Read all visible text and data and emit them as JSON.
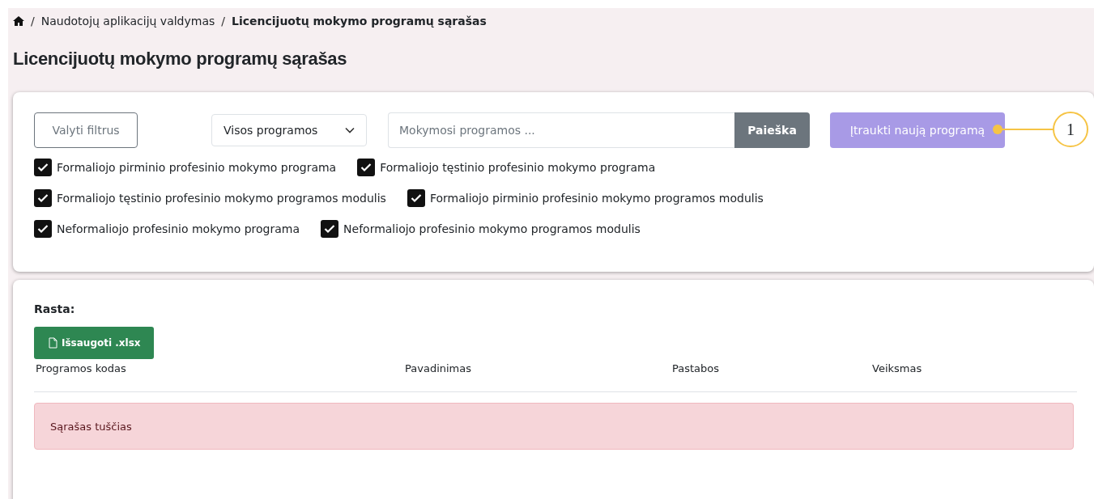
{
  "breadcrumb": {
    "items": [
      {
        "separator": "/",
        "label": "Naudotojų aplikacijų valdymas",
        "current": false
      },
      {
        "separator": "/",
        "label": "Licencijuotų mokymo programų sąrašas",
        "current": true
      }
    ]
  },
  "title": "Licencijuotų mokymo programų sąrašas",
  "filters": {
    "clear_button": "Valyti filtrus",
    "dropdown": "Visos programos",
    "search": {
      "placeholder": "Mokymosi programos ...",
      "button": "Paieška"
    },
    "add_button": "Įtraukti naują programą",
    "callout": "1",
    "checkbox_rows": [
      [
        {
          "label": "Formaliojo pirminio profesinio mokymo programa",
          "checked": true
        },
        {
          "label": "Formaliojo tęstinio profesinio mokymo programa",
          "checked": true
        }
      ],
      [
        {
          "label": "Formaliojo tęstinio profesinio mokymo programos modulis",
          "checked": true
        },
        {
          "label": "Formaliojo pirminio profesinio mokymo programos modulis",
          "checked": true
        }
      ],
      [
        {
          "label": "Neformaliojo profesinio mokymo programa",
          "checked": true
        },
        {
          "label": "Neformaliojo profesinio mokymo programos modulis",
          "checked": true
        }
      ]
    ]
  },
  "results": {
    "label": "Rasta:",
    "export_button": "Išsaugoti .xlsx",
    "columns": [
      "Programos kodas",
      "Pavadinimas",
      "Pastabos",
      "Veiksmas"
    ],
    "empty_message": "Sąrašas tuščias"
  }
}
